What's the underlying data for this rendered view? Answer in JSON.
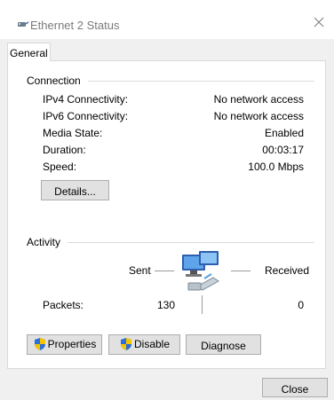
{
  "window": {
    "title": "Ethernet 2 Status",
    "icon": "network-adapter-icon"
  },
  "tabs": [
    {
      "label": "General"
    }
  ],
  "connection": {
    "heading": "Connection",
    "rows": [
      {
        "label": "IPv4 Connectivity:",
        "value": "No network access"
      },
      {
        "label": "IPv6 Connectivity:",
        "value": "No network access"
      },
      {
        "label": "Media State:",
        "value": "Enabled"
      },
      {
        "label": "Duration:",
        "value": "00:03:17"
      },
      {
        "label": "Speed:",
        "value": "100.0 Mbps"
      }
    ],
    "details_button": "Details..."
  },
  "activity": {
    "heading": "Activity",
    "sent_label": "Sent",
    "received_label": "Received",
    "packets_label": "Packets:",
    "packets_sent": "130",
    "packets_received": "0",
    "icon": "network-computers-icon"
  },
  "buttons": {
    "properties": "Properties",
    "disable": "Disable",
    "diagnose": "Diagnose",
    "close": "Close"
  },
  "colors": {
    "shield_blue": "#2b6fd6",
    "shield_yellow": "#f5c400",
    "title_text": "#7a7a7a",
    "button_face": "#e1e1e1",
    "button_border": "#adadad"
  }
}
